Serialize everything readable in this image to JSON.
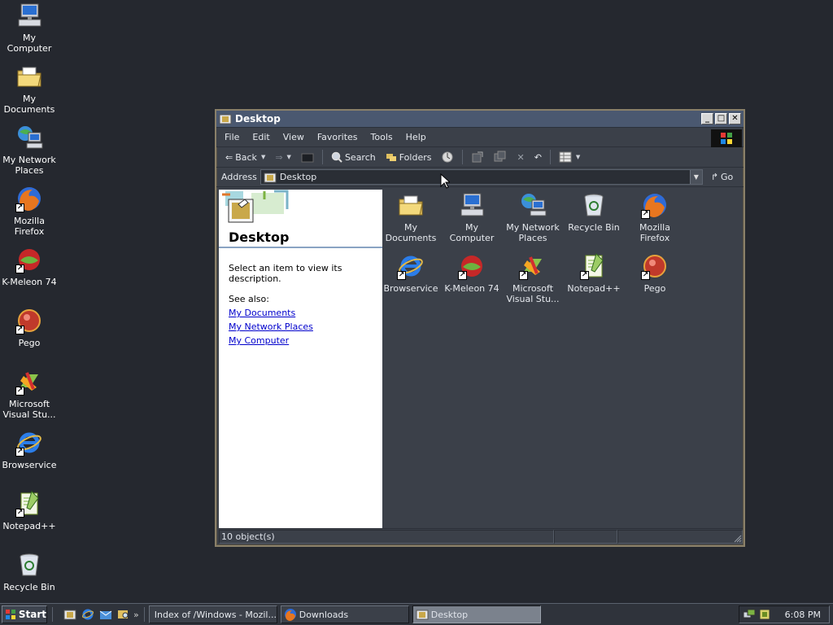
{
  "desktop": {
    "icons": [
      {
        "label": "My Computer",
        "icon": "computer-icon"
      },
      {
        "label": "My Documents",
        "icon": "folder-documents-icon"
      },
      {
        "label": "My Network\nPlaces",
        "icon": "network-places-icon"
      },
      {
        "label": "Mozilla Firefox",
        "icon": "firefox-icon"
      },
      {
        "label": "K-Meleon 74",
        "icon": "kmeleon-icon"
      },
      {
        "label": "Pego",
        "icon": "pego-icon"
      },
      {
        "label": "Microsoft\nVisual Stu...",
        "icon": "visual-studio-icon"
      },
      {
        "label": "Browservice",
        "icon": "internet-explorer-icon"
      },
      {
        "label": "Notepad++",
        "icon": "notepadpp-icon"
      },
      {
        "label": "Recycle Bin",
        "icon": "recycle-bin-icon"
      }
    ]
  },
  "window": {
    "title": "Desktop",
    "menu": [
      "File",
      "Edit",
      "View",
      "Favorites",
      "Tools",
      "Help"
    ],
    "toolbar": {
      "back": "Back",
      "search": "Search",
      "folders": "Folders"
    },
    "address": {
      "label": "Address",
      "value": "Desktop",
      "go": "Go"
    },
    "left_pane": {
      "title": "Desktop",
      "description": "Select an item to view its description.",
      "see_also": "See also:",
      "links": [
        "My Documents",
        "My Network Places",
        "My Computer"
      ]
    },
    "items": [
      {
        "label": "My Documents",
        "icon": "folder-documents-icon"
      },
      {
        "label": "My Computer",
        "icon": "computer-icon"
      },
      {
        "label": "My Network\nPlaces",
        "icon": "network-places-icon"
      },
      {
        "label": "Recycle Bin",
        "icon": "recycle-bin-icon"
      },
      {
        "label": "Mozilla Firefox",
        "icon": "firefox-icon"
      },
      {
        "label": "Browservice",
        "icon": "internet-explorer-icon"
      },
      {
        "label": "K-Meleon 74",
        "icon": "kmeleon-icon"
      },
      {
        "label": "Microsoft\nVisual Stu...",
        "icon": "visual-studio-icon"
      },
      {
        "label": "Notepad++",
        "icon": "notepadpp-icon"
      },
      {
        "label": "Pego",
        "icon": "pego-icon"
      }
    ],
    "status": "10 object(s)"
  },
  "taskbar": {
    "start": "Start",
    "tasks": [
      {
        "label": "Index of /Windows - Mozil...",
        "icon": "firefox-icon",
        "active": false
      },
      {
        "label": "Downloads",
        "icon": "firefox-icon",
        "active": false
      },
      {
        "label": "Desktop",
        "icon": "desktop-folder-icon",
        "active": true
      }
    ],
    "clock": "6:08 PM"
  }
}
